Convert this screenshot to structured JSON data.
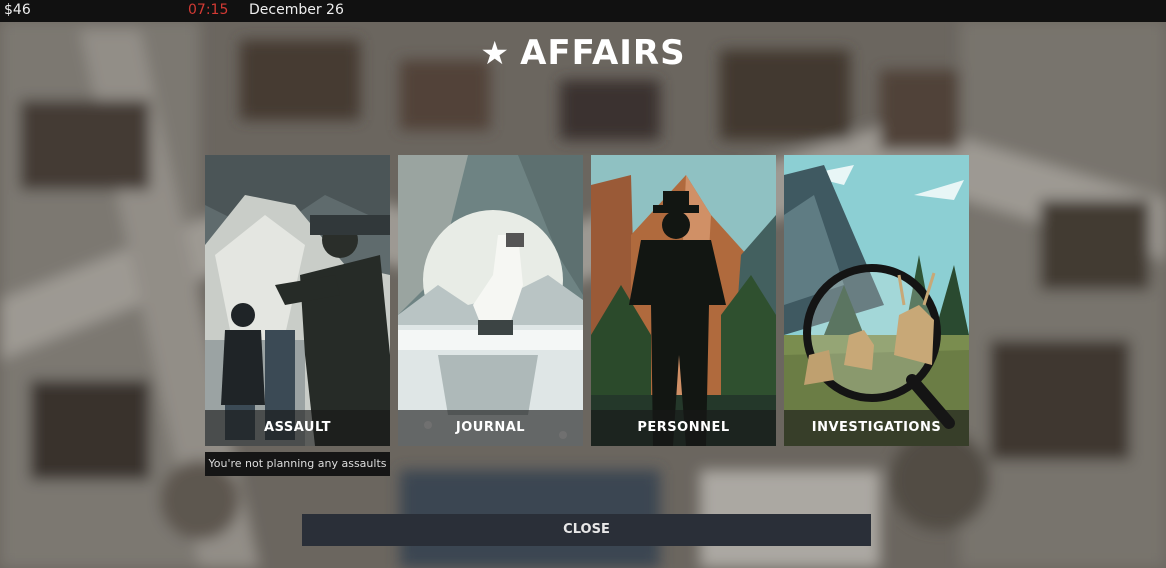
{
  "hud": {
    "money": "$46",
    "time": "07:15",
    "date": "December 26"
  },
  "dialog": {
    "title": "AFFAIRS",
    "title_icon": "star-icon"
  },
  "cards": [
    {
      "label": "ASSAULT"
    },
    {
      "label": "JOURNAL"
    },
    {
      "label": "PERSONNEL"
    },
    {
      "label": "INVESTIGATIONS"
    }
  ],
  "tooltip": "You're not planning any assaults",
  "close_label": "CLOSE",
  "colors": {
    "clock": "#d23a34",
    "button_bg": "#2a2f38",
    "topbar_bg": "#111111"
  }
}
